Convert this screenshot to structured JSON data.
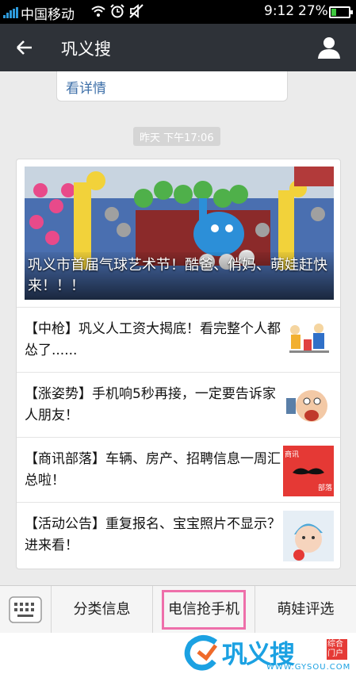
{
  "status_bar": {
    "carrier": "中国移动",
    "time": "9:12",
    "battery": "27%"
  },
  "header": {
    "title": "巩义搜"
  },
  "previous_message": {
    "link_text": "看详情"
  },
  "timestamp": "昨天 下午17:06",
  "news": {
    "headline": {
      "title": "巩义市首届气球艺术节！酷爸、俏妈、萌娃赶快来！！！"
    },
    "items": [
      {
        "title": "【中枪】巩义人工资大揭底！看完整个人都怂了......",
        "thumb_icon": "cartoon-thumbnail"
      },
      {
        "title": "【涨姿势】手机响5秒再接，一定要告诉家人朋友！",
        "thumb_icon": "cartoon-thumbnail"
      },
      {
        "title": "【商讯部落】车辆、房产、招聘信息一周汇总啦！",
        "thumb_icon": "business-news-thumbnail",
        "thumb_text": "商讯",
        "thumb_text2": "部落"
      },
      {
        "title": "【活动公告】重复报名、宝宝照片不显示？进来看！",
        "thumb_icon": "baby-photo-thumbnail"
      }
    ]
  },
  "bottom_menu": {
    "items": [
      "分类信息",
      "电信抢手机",
      "萌娃评选"
    ],
    "highlight_color": "#ee6faa"
  },
  "watermark": {
    "brand": "巩义搜",
    "domain": "WWW.GYSOU.COM",
    "badge": "综合门户"
  }
}
